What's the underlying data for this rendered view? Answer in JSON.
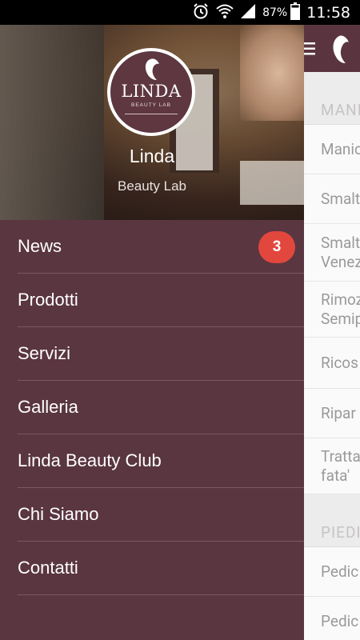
{
  "status_bar": {
    "battery_percent": "87%",
    "time": "11:58",
    "icons": [
      "alarm-icon",
      "wifi-icon",
      "signal-icon",
      "battery-icon"
    ]
  },
  "drawer": {
    "profile": {
      "logo_text": "LINDA",
      "logo_subtext": "BEAUTY LAB",
      "name": "Linda",
      "subtitle": "Beauty Lab"
    },
    "items": [
      {
        "label": "News",
        "badge": "3"
      },
      {
        "label": "Prodotti"
      },
      {
        "label": "Servizi"
      },
      {
        "label": "Galleria"
      },
      {
        "label": "Linda Beauty Club"
      },
      {
        "label": "Chi Siamo"
      },
      {
        "label": "Contatti"
      }
    ]
  },
  "background": {
    "section_1": "MANI",
    "items_1": [
      {
        "line1": "Manic"
      },
      {
        "line1": "Smalt"
      },
      {
        "line1": "Smalt",
        "line2": "Venez"
      },
      {
        "line1": "Rimoz",
        "line2": "Semip"
      },
      {
        "line1": "Ricos"
      },
      {
        "line1": "Ripar"
      },
      {
        "line1": "Tratta",
        "line2": "fata'"
      }
    ],
    "section_2": "PIEDI",
    "items_2": [
      {
        "line1": "Pedic"
      },
      {
        "line1": "Pedic"
      }
    ]
  },
  "colors": {
    "drawer_bg": "#5a3641",
    "badge": "#e2473d",
    "toolbar": "#5a3540"
  }
}
